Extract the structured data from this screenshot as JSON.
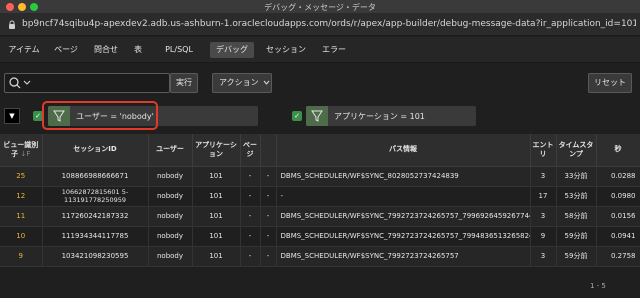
{
  "window": {
    "title": "デバッグ・メッセージ・データ"
  },
  "browser": {
    "url": "bp9ncf74sqibu4p-apexdev2.adb.us-ashburn-1.oraclecloudapps.com/ords/r/apex/app-builder/debug-message-data?ir_application_id=101&ir_pa..."
  },
  "tabs": [
    {
      "label": "アイテム"
    },
    {
      "label": "ページ"
    },
    {
      "label": "問合せ"
    },
    {
      "label": "表"
    },
    {
      "label": "PL/SQL"
    },
    {
      "label": "デバッグ"
    },
    {
      "label": "セッション"
    },
    {
      "label": "エラー"
    }
  ],
  "toolbar": {
    "search_value": "",
    "go_label": "実行",
    "actions_label": "アクション",
    "reset_label": "リセット"
  },
  "filters": [
    {
      "text": "ユーザー = 'nobody'"
    },
    {
      "text": "アプリケーション = 101"
    }
  ],
  "table": {
    "headers": [
      "ビュー識別子",
      "セッションID",
      "ユーザー",
      "アプリケーション",
      "ページ",
      "",
      "パス情報",
      "エントリ",
      "タイムスタンプ",
      "秒"
    ],
    "rows": [
      [
        "25",
        "108866988666671",
        "nobody",
        "101",
        "-",
        "-",
        "DBMS_SCHEDULER/WF$SYNC_8028052737424839",
        "3",
        "33分前",
        "0.0288"
      ],
      [
        "12",
        "10662872815601 5-113191778250959",
        "nobody",
        "101",
        "-",
        "-",
        "-",
        "17",
        "53分前",
        "0.0980"
      ],
      [
        "11",
        "117260242187332",
        "nobody",
        "101",
        "-",
        "-",
        "DBMS_SCHEDULER/WF$SYNC_7992723724265757_7996926459267744",
        "3",
        "58分前",
        "0.0156"
      ],
      [
        "10",
        "111934344117785",
        "nobody",
        "101",
        "-",
        "-",
        "DBMS_SCHEDULER/WF$SYNC_7992723724265757_7994836513265824",
        "9",
        "59分前",
        "0.0941"
      ],
      [
        "9",
        "103421098230595",
        "nobody",
        "101",
        "-",
        "-",
        "DBMS_SCHEDULER/WF$SYNC_7992723724265757",
        "3",
        "59分前",
        "0.2758"
      ]
    ]
  },
  "pagination": {
    "text": "1 - 5"
  }
}
